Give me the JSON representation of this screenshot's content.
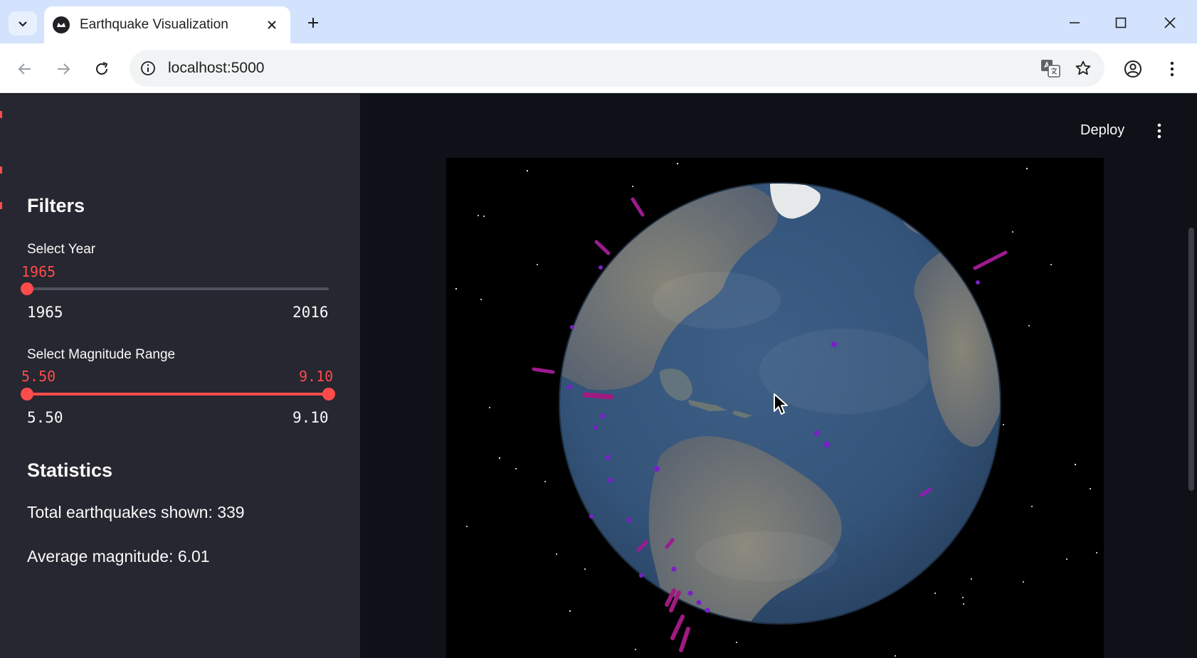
{
  "browser": {
    "tab_title": "Earthquake Visualization",
    "url": "localhost:5000"
  },
  "sidebar": {
    "filters_heading": "Filters",
    "year": {
      "label": "Select Year",
      "value": "1965",
      "min": "1965",
      "max": "2016",
      "value_fraction": 0.0
    },
    "magnitude": {
      "label": "Select Magnitude Range",
      "low": "5.50",
      "high": "9.10",
      "min": "5.50",
      "max": "9.10",
      "low_fraction": 0.0,
      "high_fraction": 1.0
    },
    "statistics_heading": "Statistics",
    "total_text": "Total earthquakes shown: 339",
    "average_text": "Average magnitude: 6.01"
  },
  "header": {
    "deploy_label": "Deploy"
  },
  "colors": {
    "accent": "#ff4b4b",
    "sidebar_bg": "#262730",
    "app_bg": "#0e1117",
    "quake_marker": "#8b1a8b",
    "quake_dot": "#7a1fc9"
  }
}
